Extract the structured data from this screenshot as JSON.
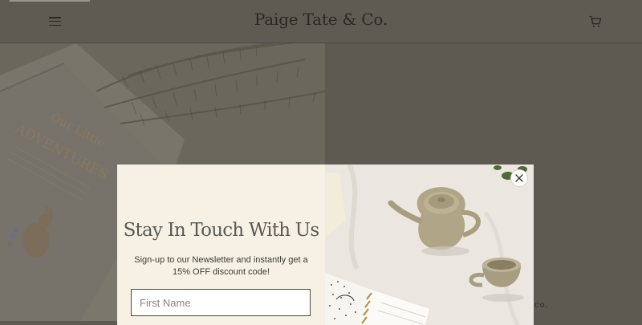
{
  "header": {
    "brand": "Paige Tate & Co.",
    "menu_icon": "hamburger-menu-icon",
    "cart_icon": "shopping-cart-icon"
  },
  "background": {
    "brand_fragment": "co."
  },
  "popup": {
    "title": "Stay In Touch With Us",
    "subtitle": "Sign-up to our Newsletter and instantly get a 15% OFF discount code!",
    "first_name_placeholder": "First Name",
    "close_icon": "close-icon"
  },
  "colors": {
    "page_overlay": "#5e5a52",
    "popup_background": "#f6f1e4",
    "input_border": "#4a4843"
  }
}
